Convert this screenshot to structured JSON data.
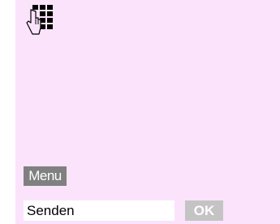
{
  "screen": {
    "background": "#fbe3fb",
    "top_icon": "keypad-hand-icon"
  },
  "softkeys": {
    "menu_label": "Menu",
    "ok_label": "OK"
  },
  "bottom_field": {
    "value": "Senden"
  },
  "colors": {
    "menu_bg": "#808080",
    "ok_bg": "#c4c4c4"
  }
}
